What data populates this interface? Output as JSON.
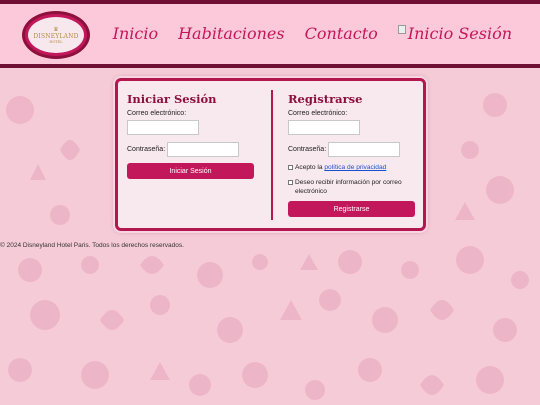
{
  "header": {
    "logo": {
      "brand": "DISNEYLAND",
      "sub": "HOTEL",
      "crest": "♛"
    },
    "nav": [
      "Inicio",
      "Habitaciones",
      "Contacto",
      "Inicio Sesión"
    ]
  },
  "login": {
    "title": "Iniciar Sesión",
    "email_label": "Correo electrónico:",
    "password_label": "Contraseña:",
    "submit_label": "Iniciar Sesión"
  },
  "register": {
    "title": "Registrarse",
    "email_label": "Correo electrónico:",
    "password_label": "Contraseña:",
    "privacy_prefix": "Acepto la ",
    "privacy_link": "política de privacidad",
    "newsletter_label": "Deseo recibir información por correo electrónico",
    "submit_label": "Registrarse"
  },
  "footer": {
    "text": "© 2024 Disneyland Hotel Paris. Todos los derechos reservados."
  },
  "colors": {
    "accent": "#c2185b",
    "dark": "#6e0f33",
    "background": "#f6cbd8",
    "panel": "#f8e9ee"
  }
}
